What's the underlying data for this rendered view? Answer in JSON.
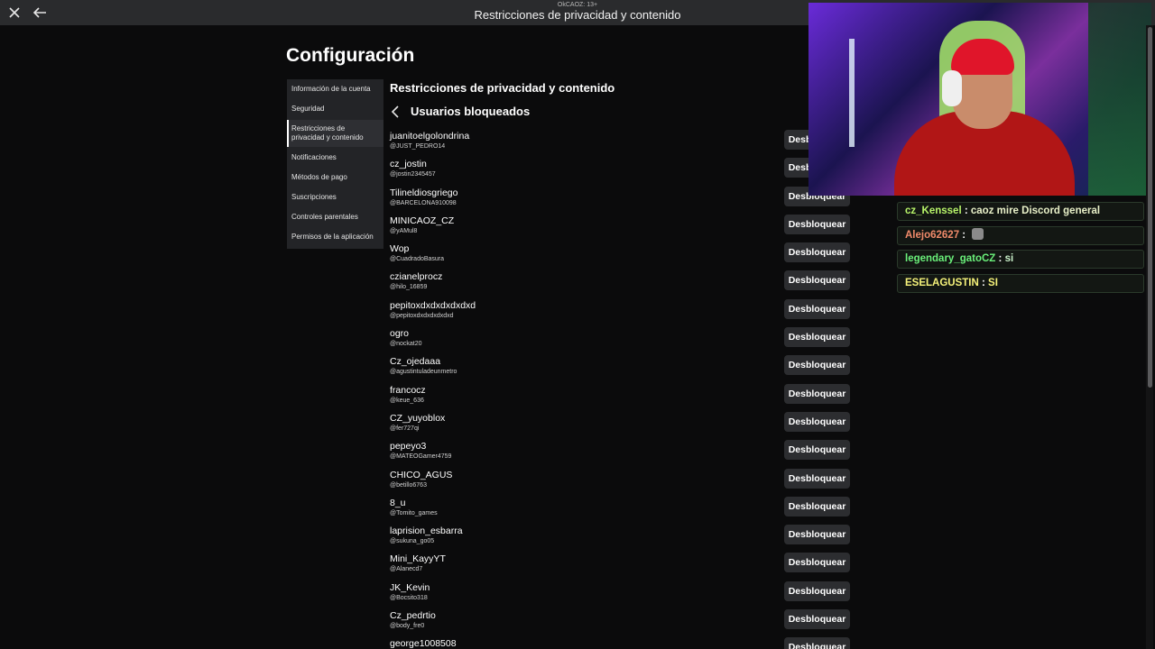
{
  "topbar": {
    "subtitle": "OkCAOZ: 13+",
    "title": "Restricciones de privacidad y contenido"
  },
  "settings": {
    "page_title": "Configuración",
    "sidebar": [
      {
        "label": "Información de la cuenta",
        "active": false
      },
      {
        "label": "Seguridad",
        "active": false
      },
      {
        "label": "Restricciones de privacidad y contenido",
        "active": true
      },
      {
        "label": "Notificaciones",
        "active": false
      },
      {
        "label": "Métodos de pago",
        "active": false
      },
      {
        "label": "Suscripciones",
        "active": false
      },
      {
        "label": "Controles parentales",
        "active": false
      },
      {
        "label": "Permisos de la aplicación",
        "active": false
      }
    ],
    "section_title": "Restricciones de privacidad y contenido",
    "subsection_title": "Usuarios bloqueados",
    "unblock_label": "Desbloquear",
    "blocked_users": [
      {
        "name": "juanitoelgolondrina",
        "handle": "@JUST_PEDRO14"
      },
      {
        "name": "cz_jostin",
        "handle": "@jostin2345457"
      },
      {
        "name": "Tilineldiosgriego",
        "handle": "@BARCELONA910098"
      },
      {
        "name": "MINICAOZ_CZ",
        "handle": "@yAMul8"
      },
      {
        "name": "Wop",
        "handle": "@CuadradoBasura"
      },
      {
        "name": "czianelprocz",
        "handle": "@hilo_16859"
      },
      {
        "name": "pepitoxdxdxdxdxdxd",
        "handle": "@pepitoxdxdxdxdxdxd"
      },
      {
        "name": "ogro",
        "handle": "@nockat20"
      },
      {
        "name": "Cz_ojedaaa",
        "handle": "@agustintuladeunmetro"
      },
      {
        "name": "francocz",
        "handle": "@keue_636"
      },
      {
        "name": "CZ_yuyoblox",
        "handle": "@fer727qi"
      },
      {
        "name": "pepeyo3",
        "handle": "@MATEOGamer4759"
      },
      {
        "name": "CHICO_AGUS",
        "handle": "@betillo6763"
      },
      {
        "name": "8_u",
        "handle": "@Tomito_games"
      },
      {
        "name": "laprision_esbarra",
        "handle": "@sukuna_go05"
      },
      {
        "name": "Mini_KayyYT",
        "handle": "@Alanecd7"
      },
      {
        "name": "JK_Kevin",
        "handle": "@Bocsito318"
      },
      {
        "name": "Cz_pedrtio",
        "handle": "@body_fre0"
      },
      {
        "name": "george1008508",
        "handle": ""
      }
    ]
  },
  "chat": {
    "messages": [
      {
        "user": "cz_Kenssel",
        "text": "caoz mire Discord general",
        "user_color": "#b8f56a",
        "text_color": "#e8f0c8",
        "emote": false
      },
      {
        "user": "Alejo62627",
        "text": "",
        "user_color": "#f08a6a",
        "text_color": "#ffffff",
        "emote": true
      },
      {
        "user": "legendary_gatoCZ",
        "text": "si",
        "user_color": "#6af07a",
        "text_color": "#c8f0c8",
        "emote": false
      },
      {
        "user": "ESELAGUSTIN",
        "text": "SI",
        "user_color": "#f5f27a",
        "text_color": "#f5f27a",
        "emote": false
      }
    ]
  },
  "icons": {
    "close": "close-icon",
    "back": "arrow-left-icon",
    "chevron": "chevron-left-icon"
  }
}
